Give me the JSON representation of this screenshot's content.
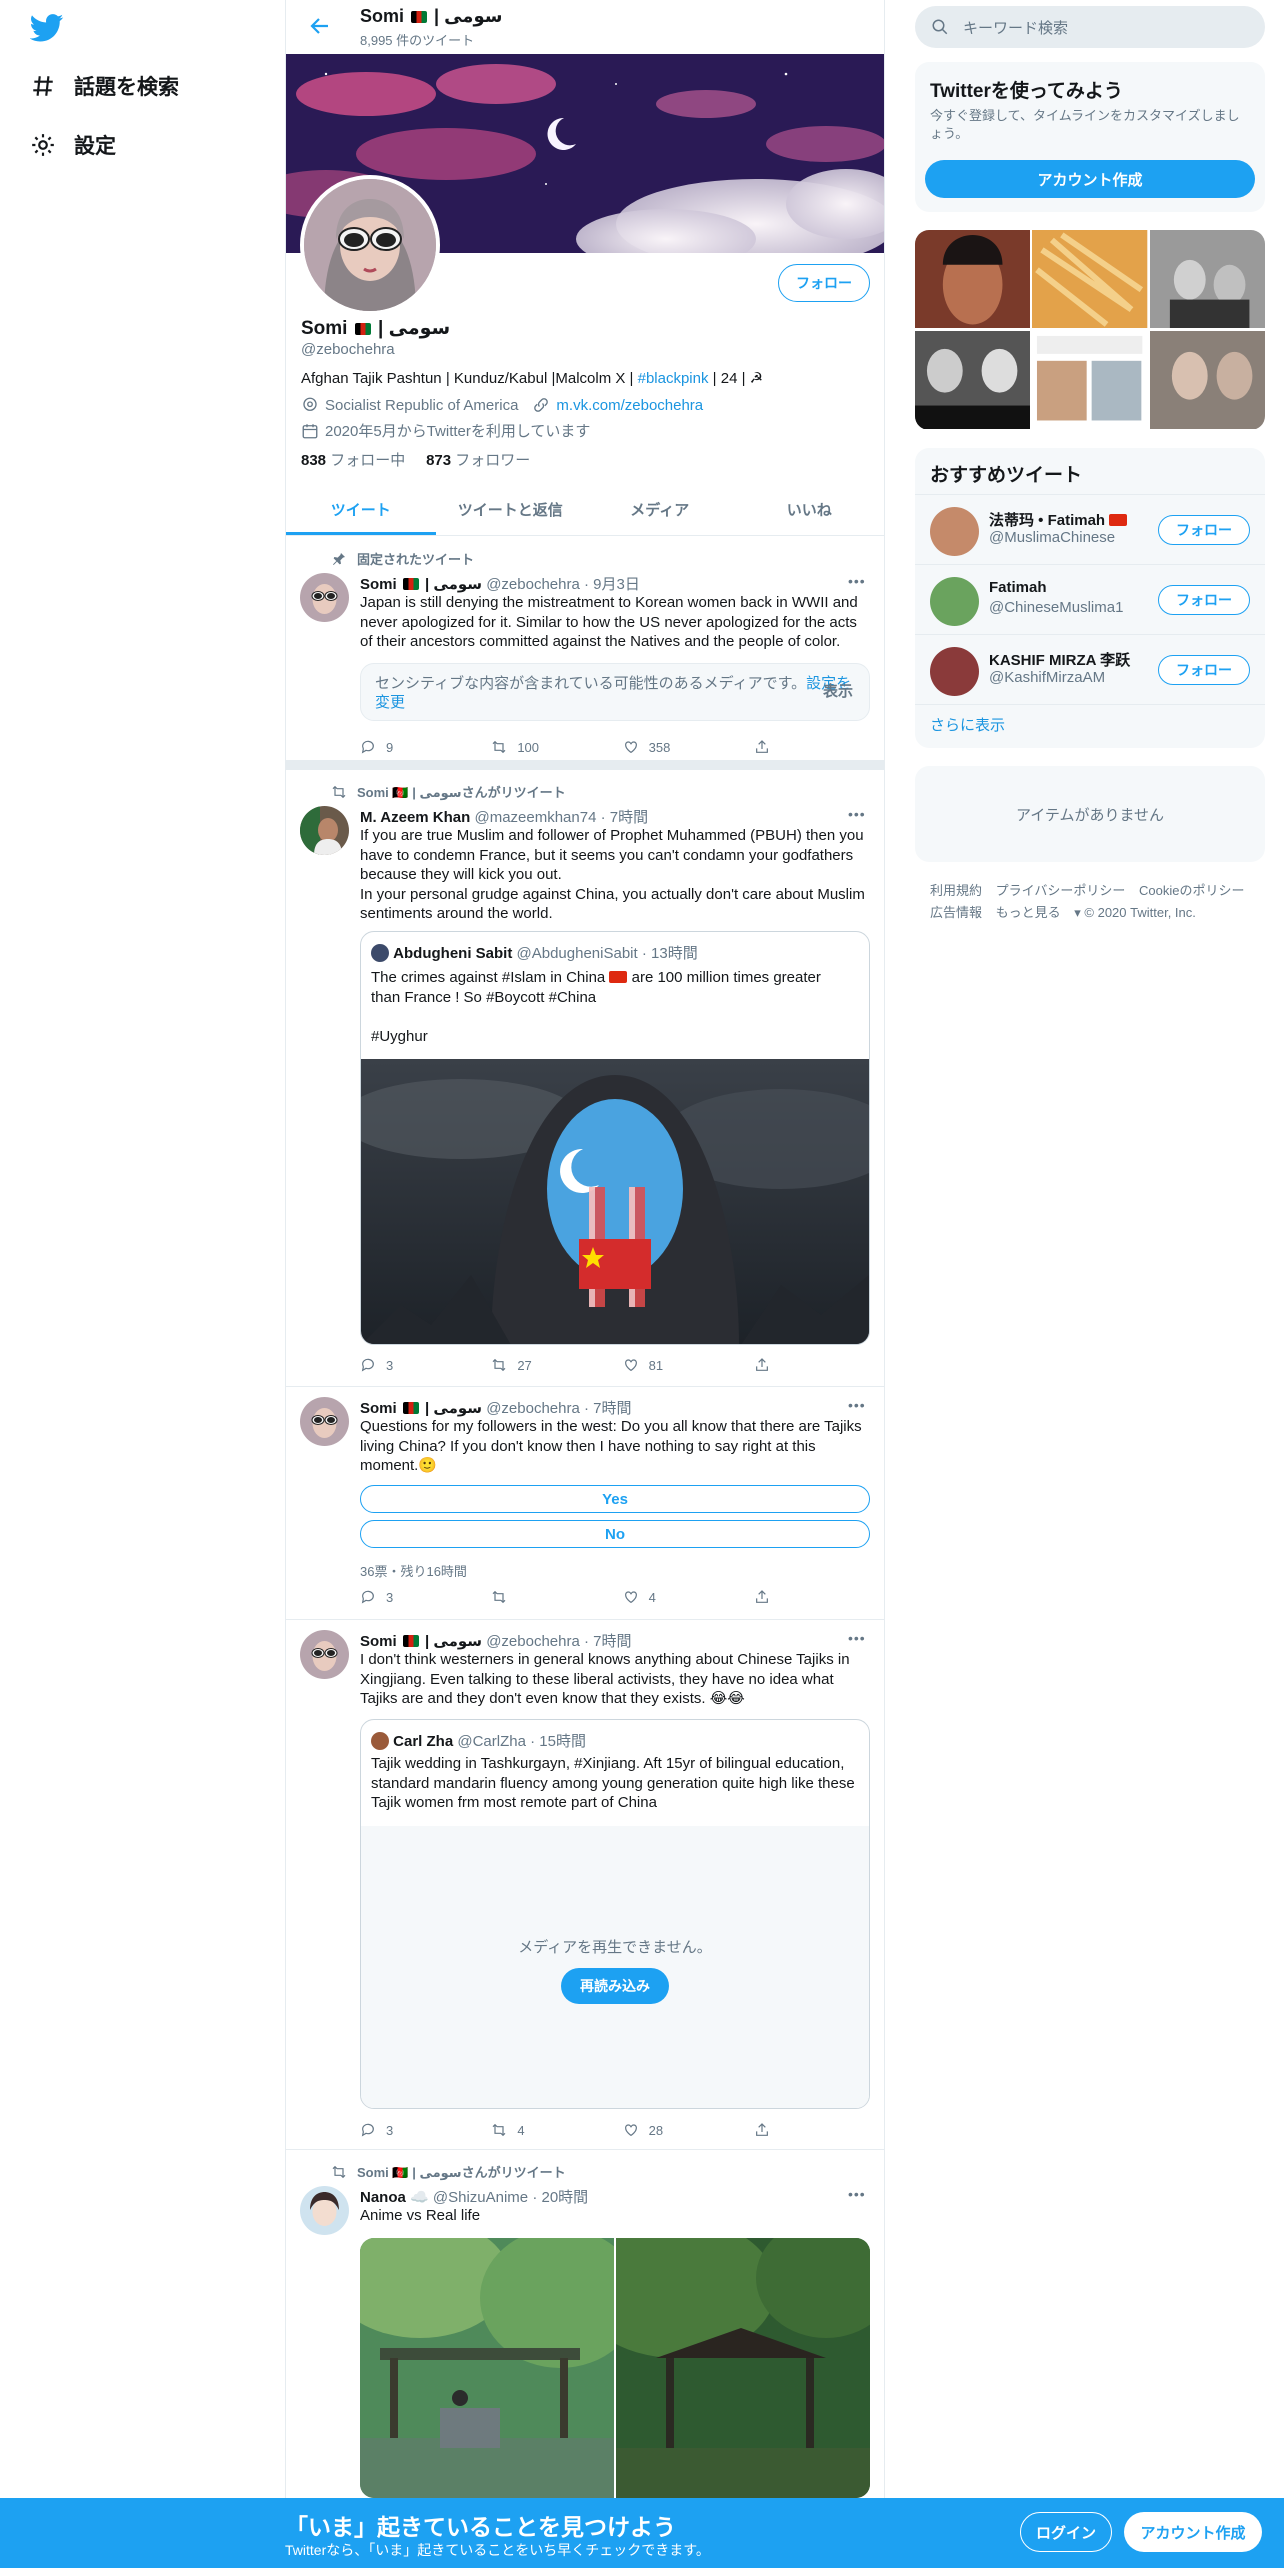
{
  "nav": {
    "explore": "話題を検索",
    "settings": "設定"
  },
  "header": {
    "name": "Somi",
    "name_suffix": "| سومی",
    "tweet_count": "8,995 件のツイート"
  },
  "profile": {
    "follow": "フォロー",
    "name": "Somi",
    "name_suffix": "| سومی",
    "handle": "@zebochehra",
    "bio_pre": "Afghan Tajik Pashtun | Kunduz/Kabul |Malcolm X |",
    "bio_tag": "#blackpink",
    "bio_post": "| 24 | ☭",
    "location": "Socialist Republic of America",
    "link": "m.vk.com/zebochehra",
    "joined": "2020年5月からTwitterを利用しています",
    "following_count": "838",
    "following_label": "フォロー中",
    "followers_count": "873",
    "followers_label": "フォロワー"
  },
  "tabs": [
    "ツイート",
    "ツイートと返信",
    "メディア",
    "いいね"
  ],
  "tweets": [
    {
      "context": "固定されたツイート",
      "name": "Somi",
      "name_suffix": "| سومی",
      "handle": "@zebochehra",
      "time": "9月3日",
      "text": "Japan is still denying the mistreatment to Korean women back in WWII and never apologized for it. Similar to how the US never apologized for the acts of their ancestors committed against the Natives and the people of color.",
      "sensitive_text": "センシティブな内容が含まれている可能性のあるメディアです。",
      "sensitive_link": "設定を変更",
      "sensitive_show": "表示",
      "replies": "9",
      "retweets": "100",
      "likes": "358"
    },
    {
      "context": "Somi 🇦🇫 | سومیさんがリツイート",
      "name": "M. Azeem Khan",
      "handle": "@mazeemkhan74",
      "time": "7時間",
      "text1": "If you are true Muslim and follower of Prophet Muhammed (PBUH) then you have to condemn France, but it seems you can't condamn your godfathers because they will kick you out.",
      "text2": "In your personal grudge against China, you actually don't care about Muslim sentiments around the world.",
      "quote_name": "Abdugheni Sabit",
      "quote_handle": "@AbdugheniSabit",
      "quote_time": "13時間",
      "quote_text1_a": "The crimes against #Islam in China",
      "quote_text1_b": "are 100 million times greater than France ! So #Boycott #China",
      "quote_text2": "#Uyghur",
      "replies": "3",
      "retweets": "27",
      "likes": "81"
    },
    {
      "name": "Somi",
      "name_suffix": "| سومی",
      "handle": "@zebochehra",
      "time": "7時間",
      "text": "Questions for my followers in the west: Do you all know that there are Tajiks living China? If you don't know then I have nothing to say right at this moment.🙂",
      "poll_yes": "Yes",
      "poll_no": "No",
      "poll_meta": "36票・残り16時間",
      "replies": "3",
      "retweets": "",
      "likes": "4"
    },
    {
      "name": "Somi",
      "name_suffix": "| سومی",
      "handle": "@zebochehra",
      "time": "7時間",
      "text": "I don't think westerners in general knows anything about Chinese Tajiks in Xingjiang. Even talking to these liberal activists, they have no idea what Tajiks are and they don't even know that they exists. 😂😂",
      "quote_name": "Carl Zha",
      "quote_handle": "@CarlZha",
      "quote_time": "15時間",
      "quote_text": "Tajik wedding in Tashkurgayn, #Xinjiang. Aft 15yr of bilingual education, standard mandarin fluency among young generation quite high like these Tajik women frm most remote part of China",
      "media_error": "メディアを再生できません。",
      "reload": "再読み込み",
      "replies": "3",
      "retweets": "4",
      "likes": "28"
    },
    {
      "context": "Somi 🇦🇫 | سومیさんがリツイート",
      "name": "Nanoa",
      "handle": "@ShizuAnime",
      "time": "20時間",
      "text": "Anime vs Real life"
    }
  ],
  "right": {
    "search_placeholder": "キーワード検索",
    "signup_title": "Twitterを使ってみよう",
    "signup_sub": "今すぐ登録して、タイムラインをカスタマイズしましょう。",
    "signup_btn": "アカウント作成",
    "suggest_title": "おすすめツイート",
    "suggestions": [
      {
        "name": "法蒂玛 • Fatimah",
        "handle": "@MuslimaChinese",
        "btn": "フォロー"
      },
      {
        "name": "Fatimah",
        "handle": "@ChineseMuslima1",
        "btn": "フォロー"
      },
      {
        "name": "KASHIF MIRZA 李跃",
        "handle": "@KashifMirzaAM",
        "btn": "フォロー"
      }
    ],
    "show_more": "さらに表示",
    "empty": "アイテムがありません",
    "footer": [
      "利用規約",
      "プライバシーポリシー",
      "Cookieのポリシー",
      "広告情報",
      "もっと見る",
      "© 2020 Twitter, Inc."
    ]
  },
  "bottombar": {
    "title": "「いま」起きていることを見つけよう",
    "sub": "Twitterなら、「いま」起きていることをいち早くチェックできます。",
    "login": "ログイン",
    "signup": "アカウント作成"
  },
  "colors": {
    "accent": "#1da1f2",
    "text": "#14171a",
    "muted": "#657786",
    "border": "#e6ecf0"
  }
}
